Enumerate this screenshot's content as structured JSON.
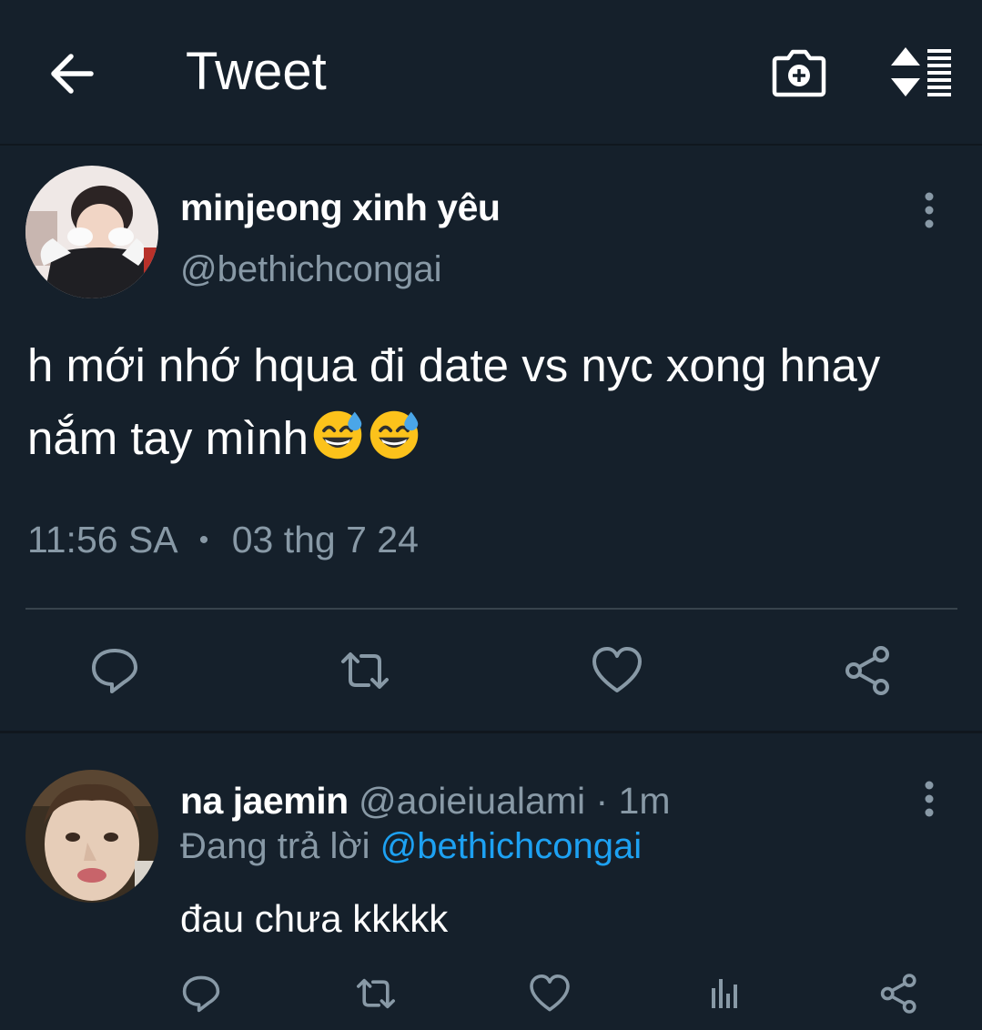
{
  "header": {
    "title": "Tweet",
    "back_icon": "arrow-left-icon",
    "camera_icon": "camera-plus-icon",
    "sort_icon": "sort-list-icon"
  },
  "tweet": {
    "author_name": "minjeong xinh yêu",
    "author_handle": "@bethichcongai",
    "text": "h mới nhớ hqua đi date vs nyc xong hnay nắm tay mình",
    "emoji": [
      "grinning-face-with-sweat",
      "grinning-face-with-sweat"
    ],
    "time": "11:56 SA",
    "dot": "•",
    "date": "03 thg 7 24",
    "actions": [
      "reply-icon",
      "retweet-icon",
      "like-icon",
      "share-icon"
    ]
  },
  "reply": {
    "author_name": "na jaemin",
    "author_handle": "@aoieiualami",
    "separator": "·",
    "age": "1m",
    "replying_prefix": "Đang trả lời",
    "replying_to": "@bethichcongai",
    "text": "đau chưa kkkkk",
    "actions": [
      "reply-icon",
      "retweet-icon",
      "like-icon",
      "analytics-icon",
      "share-icon"
    ]
  },
  "colors": {
    "background": "#15202b",
    "secondary_text": "#8899a6",
    "link": "#1da1f2",
    "divider": "#38444d"
  }
}
